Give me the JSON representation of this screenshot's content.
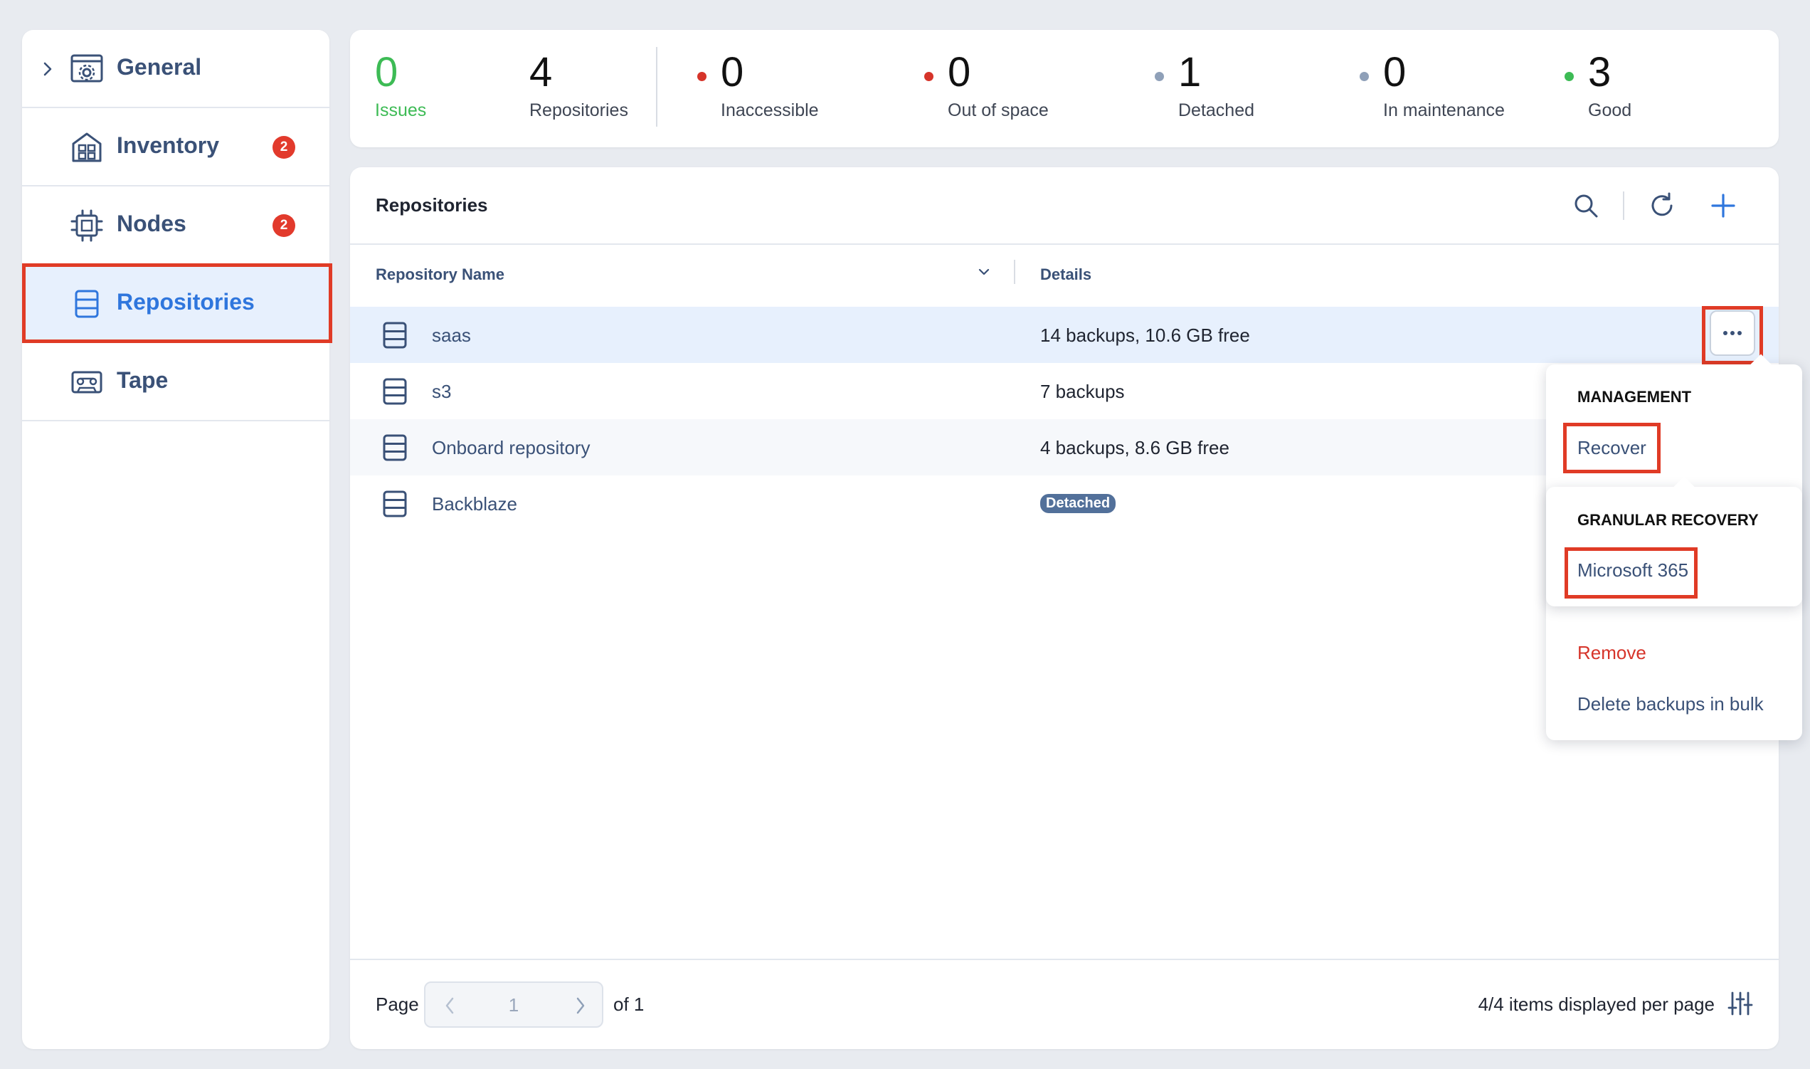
{
  "sidebar": {
    "items": [
      {
        "label": "General",
        "icon": "gear-window-icon"
      },
      {
        "label": "Inventory",
        "icon": "building-icon",
        "badge": "2"
      },
      {
        "label": "Nodes",
        "icon": "chip-icon",
        "badge": "2"
      },
      {
        "label": "Repositories",
        "icon": "database-icon"
      },
      {
        "label": "Tape",
        "icon": "tape-icon"
      }
    ]
  },
  "stats": {
    "issues": {
      "value": "0",
      "label": "Issues"
    },
    "repositories": {
      "value": "4",
      "label": "Repositories"
    },
    "inaccessible": {
      "value": "0",
      "label": "Inaccessible"
    },
    "out_of_space": {
      "value": "0",
      "label": "Out of space"
    },
    "detached": {
      "value": "1",
      "label": "Detached"
    },
    "maintenance": {
      "value": "0",
      "label": "In maintenance"
    },
    "good": {
      "value": "3",
      "label": "Good"
    }
  },
  "colors": {
    "accent": "#2f76dd",
    "issues_green": "#3dbb55",
    "danger_red": "#d6342a",
    "neutral_gray": "#8fa0b8",
    "good_green": "#3dbb55",
    "highlight": "#e03b26"
  },
  "main": {
    "title": "Repositories",
    "columns": {
      "name": "Repository Name",
      "details": "Details"
    },
    "rows": [
      {
        "name": "saas",
        "details": "14 backups, 10.6 GB free"
      },
      {
        "name": "s3",
        "details": "7 backups"
      },
      {
        "name": "Onboard repository",
        "details": "4 backups, 8.6 GB free"
      },
      {
        "name": "Backblaze",
        "details": "",
        "tag": "Detached"
      }
    ]
  },
  "menu": {
    "management_header": "MANAGEMENT",
    "recover": "Recover",
    "granular_header": "GRANULAR RECOVERY",
    "microsoft365": "Microsoft 365",
    "remove": "Remove",
    "delete_bulk": "Delete backups in bulk"
  },
  "footer": {
    "page_label": "Page",
    "page_value": "1",
    "of_label": "of 1",
    "per_page": "4/4 items displayed per page"
  }
}
